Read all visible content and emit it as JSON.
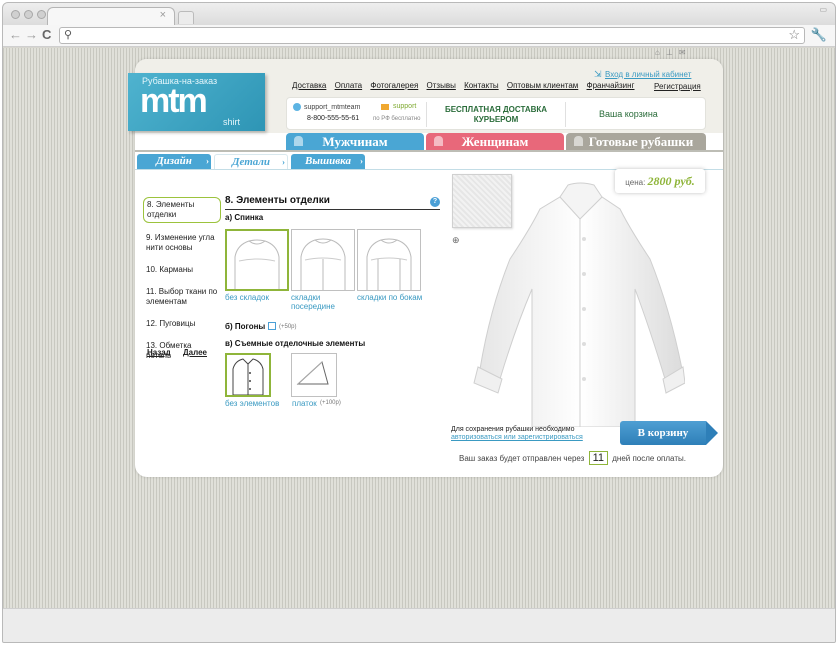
{
  "browser": {
    "tab_close": "×",
    "back_icon": "←",
    "forward_icon": "→",
    "reload_icon": "C",
    "star_icon": "☆",
    "wrench_icon": "🔧"
  },
  "site": {
    "logo": {
      "tagline": "Рубашка-на-заказ",
      "main": "mtm",
      "sub": "shirt"
    },
    "top_nav": [
      "Доставка",
      "Оплата",
      "Фотогалерея",
      "Отзывы",
      "Контакты",
      "Оптовым клиентам",
      "Франчайзинг"
    ],
    "login_label": "Вход в личный кабинет",
    "register_label": "Регистрация",
    "skype_handle": "support_mtmteam",
    "support_label": "support",
    "phone": "8-800-555-55-61",
    "phone_note": "по РФ бесплатно",
    "free_delivery": "БЕСПЛАТНАЯ ДОСТАВКА КУРЬЕРОМ",
    "cart_link": "Ваша корзина",
    "colors": {
      "blue": "#4aa6d4",
      "pink": "#e8687a",
      "grey": "#a9a69c",
      "green": "#8fb53a"
    }
  },
  "main_tabs": [
    {
      "label": "Мужчинам",
      "color": "#4aa6d4"
    },
    {
      "label": "Женщинам",
      "color": "#e8687a"
    },
    {
      "label": "Готовые рубашки",
      "color": "#a9a69c"
    }
  ],
  "sub_tabs": [
    {
      "label": "Дизайн",
      "active": false
    },
    {
      "label": "Детали",
      "active": true
    },
    {
      "label": "Вышивка",
      "active": false
    }
  ],
  "side_menu": [
    {
      "label": "8. Элементы отделки",
      "active": true
    },
    {
      "label": "9. Изменение угла нити основы",
      "active": false
    },
    {
      "label": "10. Карманы",
      "active": false
    },
    {
      "label": "11. Выбор ткани по элементам",
      "active": false
    },
    {
      "label": "12. Пуговицы",
      "active": false
    },
    {
      "label": "13. Обметка петель",
      "active": false
    }
  ],
  "nav_links": {
    "back": "Назад",
    "next": "Далее"
  },
  "section": {
    "title": "8. Элементы отделки",
    "help": "?",
    "back_heading": "а) Спинка",
    "back_options": [
      {
        "label": "без складок",
        "selected": true
      },
      {
        "label": "складки посередине",
        "selected": false
      },
      {
        "label": "складки по бокам",
        "selected": false
      }
    ],
    "epaulets_label": "б) Погоны",
    "epaulets_price": "(+50р)",
    "removable_heading": "в) Съемные отделочные элементы",
    "removable_options": [
      {
        "label": "без элементов",
        "price": "",
        "selected": true
      },
      {
        "label": "платок",
        "price": "(+100р)",
        "selected": false
      }
    ]
  },
  "preview": {
    "price_label": "цена:",
    "price_value": "2800 руб.",
    "save_note": "Для сохранения рубашки необходимо",
    "save_link": "авторизоваться или зарегистрироваться",
    "cart_button": "В корзину",
    "order_pre": "Ваш заказ будет отправлен через",
    "order_days": "11",
    "order_post": "дней после оплаты."
  }
}
